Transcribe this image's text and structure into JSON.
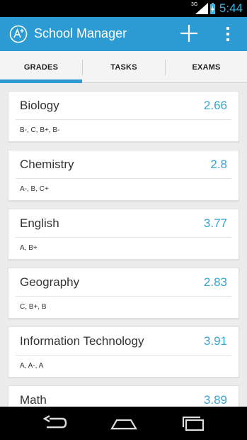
{
  "status_bar": {
    "time": "5:44",
    "network": "3G",
    "icons": [
      "signal-icon",
      "battery-charging-icon"
    ]
  },
  "action_bar": {
    "title": "School Manager",
    "logo_icon": "a-plus-logo-icon",
    "add_icon": "plus-icon",
    "overflow_icon": "overflow-menu-icon",
    "color": "#2c9bd3"
  },
  "tabs": [
    {
      "label": "GRADES",
      "selected": true
    },
    {
      "label": "TASKS",
      "selected": false
    },
    {
      "label": "EXAMS",
      "selected": false
    }
  ],
  "subjects": [
    {
      "name": "Biology",
      "average": "2.66",
      "grades": "B-, C, B+, B-"
    },
    {
      "name": "Chemistry",
      "average": "2.8",
      "grades": "A-, B, C+"
    },
    {
      "name": "English",
      "average": "3.77",
      "grades": "A, B+"
    },
    {
      "name": "Geography",
      "average": "2.83",
      "grades": "C, B+, B"
    },
    {
      "name": "Information Technology",
      "average": "3.91",
      "grades": "A, A-, A"
    },
    {
      "name": "Math",
      "average": "3.89",
      "grades": ""
    }
  ],
  "nav_bar": {
    "icons": [
      "back-icon",
      "home-icon",
      "recent-apps-icon"
    ]
  },
  "colors": {
    "accent": "#2c9bd3",
    "average_text": "#33a6d9"
  }
}
